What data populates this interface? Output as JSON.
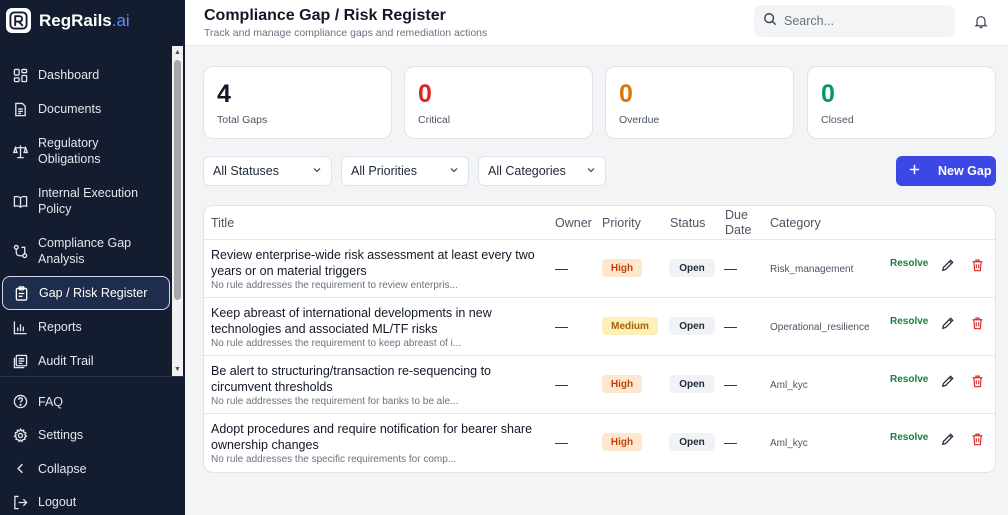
{
  "brand": {
    "name": "RegRails",
    "suffix": ".ai"
  },
  "sidebar": {
    "items": [
      {
        "label": "Dashboard",
        "icon": "dashboard-icon"
      },
      {
        "label": "Documents",
        "icon": "document-icon"
      },
      {
        "label": "Regulatory Obligations",
        "icon": "scale-icon"
      },
      {
        "label": "Internal Execution Policy",
        "icon": "book-icon"
      },
      {
        "label": "Compliance Gap Analysis",
        "icon": "route-icon"
      },
      {
        "label": "Gap / Risk Register",
        "icon": "clipboard-icon",
        "active": true
      },
      {
        "label": "Reports",
        "icon": "bar-chart-icon"
      },
      {
        "label": "Audit Trail",
        "icon": "list-icon"
      }
    ],
    "bottom": [
      {
        "label": "FAQ",
        "icon": "help-icon"
      },
      {
        "label": "Settings",
        "icon": "gear-icon"
      },
      {
        "label": "Collapse",
        "icon": "chevron-left-icon"
      },
      {
        "label": "Logout",
        "icon": "logout-icon"
      }
    ]
  },
  "header": {
    "title": "Compliance Gap / Risk Register",
    "subtitle": "Track and manage compliance gaps and remediation actions",
    "search_placeholder": "Search..."
  },
  "stats": [
    {
      "value": "4",
      "label": "Total Gaps",
      "color": "#111827"
    },
    {
      "value": "0",
      "label": "Critical",
      "color": "#dc2626"
    },
    {
      "value": "0",
      "label": "Overdue",
      "color": "#d97706"
    },
    {
      "value": "0",
      "label": "Closed",
      "color": "#059669"
    }
  ],
  "filters": {
    "status": "All Statuses",
    "priority": "All Priorities",
    "category": "All Categories"
  },
  "new_gap_label": "New Gap",
  "table": {
    "headers": {
      "title": "Title",
      "owner": "Owner",
      "priority": "Priority",
      "status": "Status",
      "due": "Due Date",
      "category": "Category"
    },
    "rows": [
      {
        "title": "Review enterprise-wide risk assessment at least every two years or on material triggers",
        "desc": "No rule addresses the requirement to review enterpris...",
        "owner": "—",
        "priority": "High",
        "status": "Open",
        "due": "—",
        "category": "Risk_management",
        "action": "Resolve"
      },
      {
        "title": "Keep abreast of international developments in new technologies and associated ML/TF risks",
        "desc": "No rule addresses the requirement to keep abreast of i...",
        "owner": "—",
        "priority": "Medium",
        "status": "Open",
        "due": "—",
        "category": "Operational_resilience",
        "action": "Resolve"
      },
      {
        "title": "Be alert to structuring/transaction re-sequencing to circumvent thresholds",
        "desc": "No rule addresses the requirement for banks to be ale...",
        "owner": "—",
        "priority": "High",
        "status": "Open",
        "due": "—",
        "category": "Aml_kyc",
        "action": "Resolve"
      },
      {
        "title": "Adopt procedures and require notification for bearer share ownership changes",
        "desc": "No rule addresses the specific requirements for comp...",
        "owner": "—",
        "priority": "High",
        "status": "Open",
        "due": "—",
        "category": "Aml_kyc",
        "action": "Resolve"
      }
    ]
  },
  "colors": {
    "sidebar_bg": "#141c2f",
    "accent": "#3b48e6",
    "high_bg": "#fde8cf",
    "high_fg": "#c2410c",
    "medium_bg": "#fdefb8",
    "medium_fg": "#a16207",
    "resolve": "#15803d",
    "delete": "#dc2626"
  }
}
